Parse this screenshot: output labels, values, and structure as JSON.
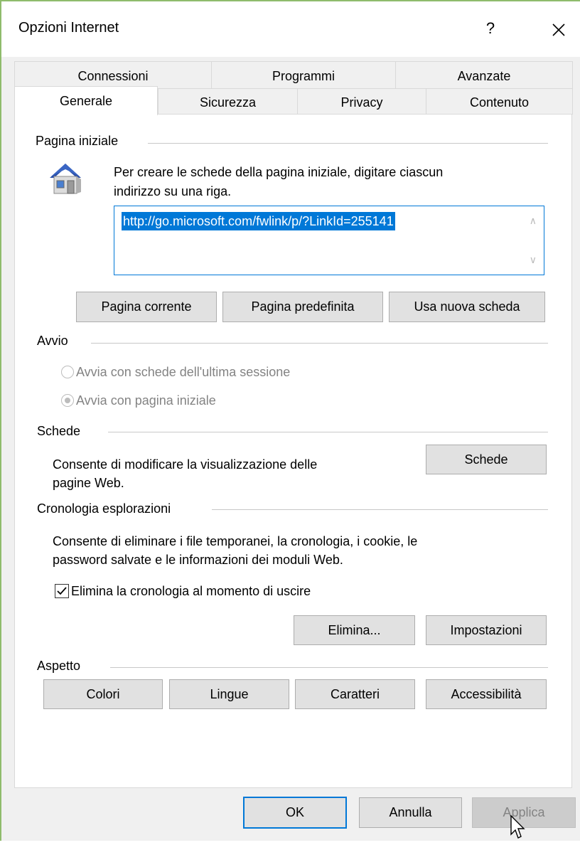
{
  "window": {
    "title": "Opzioni Internet",
    "help_label": "?",
    "close_label": "✕"
  },
  "tabs": {
    "row1": [
      "Connessioni",
      "Programmi",
      "Avanzate"
    ],
    "row2": [
      "Generale",
      "Sicurezza",
      "Privacy",
      "Contenuto"
    ],
    "active": "Generale"
  },
  "homepage": {
    "group_label": "Pagina iniziale",
    "description_line1": "Per creare le schede della pagina iniziale, digitare ciascun",
    "description_line2": "indirizzo su una riga.",
    "url_value": "http://go.microsoft.com/fwlink/p/?LinkId=255141",
    "buttons": {
      "current": "Pagina corrente",
      "default": "Pagina predefinita",
      "new_tab": "Usa nuova scheda"
    },
    "icon": "home-icon"
  },
  "startup": {
    "group_label": "Avvio",
    "option_last_session": "Avvia con schede dell'ultima sessione",
    "option_homepage": "Avvia con pagina iniziale",
    "selected": "Avvia con pagina iniziale",
    "enabled": false
  },
  "tabs_section": {
    "group_label": "Schede",
    "description_line1": "Consente di modificare la visualizzazione delle",
    "description_line2": "pagine Web.",
    "button": "Schede"
  },
  "history": {
    "group_label": "Cronologia esplorazioni",
    "description_line1": "Consente di eliminare i file temporanei, la cronologia, i cookie, le",
    "description_line2": "password salvate e le informazioni dei moduli Web.",
    "checkbox_label": "Elimina la cronologia al momento di uscire",
    "checkbox_checked": true,
    "delete_button": "Elimina...",
    "settings_button": "Impostazioni"
  },
  "appearance": {
    "group_label": "Aspetto",
    "buttons": {
      "colors": "Colori",
      "languages": "Lingue",
      "fonts": "Caratteri",
      "accessibility": "Accessibilità"
    }
  },
  "footer": {
    "ok": "OK",
    "cancel": "Annulla",
    "apply": "Applica",
    "apply_enabled": false
  },
  "colors": {
    "accent": "#0078d7",
    "dialog_bg": "#f0f0f0",
    "disabled_text": "#838383"
  }
}
